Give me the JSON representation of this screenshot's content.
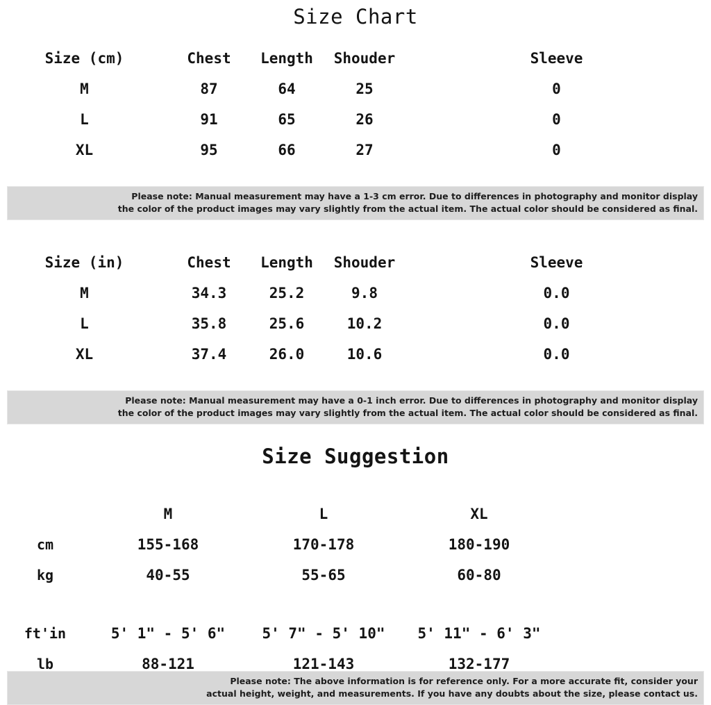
{
  "titles": {
    "size_chart": "Size Chart",
    "size_suggestion": "Size Suggestion"
  },
  "table_cm": {
    "headers": [
      "Size (cm)",
      "Chest",
      "Length",
      "Shouder",
      "Sleeve"
    ],
    "rows": [
      [
        "M",
        "87",
        "64",
        "25",
        "0"
      ],
      [
        "L",
        "91",
        "65",
        "26",
        "0"
      ],
      [
        "XL",
        "95",
        "66",
        "27",
        "0"
      ]
    ]
  },
  "table_in": {
    "headers": [
      "Size (in)",
      "Chest",
      "Length",
      "Shouder",
      "Sleeve"
    ],
    "rows": [
      [
        "M",
        "34.3",
        "25.2",
        "9.8",
        "0.0"
      ],
      [
        "L",
        "35.8",
        "25.6",
        "10.2",
        "0.0"
      ],
      [
        "XL",
        "37.4",
        "26.0",
        "10.6",
        "0.0"
      ]
    ]
  },
  "note_cm": {
    "line1": "Please note: Manual measurement may have a 1-3 cm error. Due to differences in photography and monitor display",
    "line2": "the color of the product images may vary slightly from the actual item. The actual color should be considered as final."
  },
  "note_in": {
    "line1": "Please note: Manual measurement may have a 0-1 inch error. Due to differences in photography and monitor display",
    "line2": "the color of the product images may vary slightly from the actual item. The actual color should be considered as final."
  },
  "note_fit": {
    "line1": "Please note: The above information is for reference only. For a more accurate fit, consider your",
    "line2": "actual height, weight, and measurements. If you have any doubts about the size, please contact us."
  },
  "table_suggestion": {
    "headers": [
      "",
      "M",
      "L",
      "XL"
    ],
    "rows": [
      {
        "label": "cm",
        "values": [
          "155-168",
          "170-178",
          "180-190"
        ]
      },
      {
        "label": "kg",
        "values": [
          "40-55",
          "55-65",
          "60-80"
        ]
      },
      {
        "label": "ft'in",
        "values": [
          "5' 1\" - 5' 6\"",
          "5' 7\" - 5' 10\"",
          "5' 11\" - 6' 3\""
        ]
      },
      {
        "label": "lb",
        "values": [
          "88-121",
          "121-143",
          "132-177"
        ]
      }
    ]
  },
  "colors": {
    "background": "#ffffff",
    "text": "#141414",
    "note_band": "#d7d7d7",
    "note_border": "#e6e6e6"
  }
}
